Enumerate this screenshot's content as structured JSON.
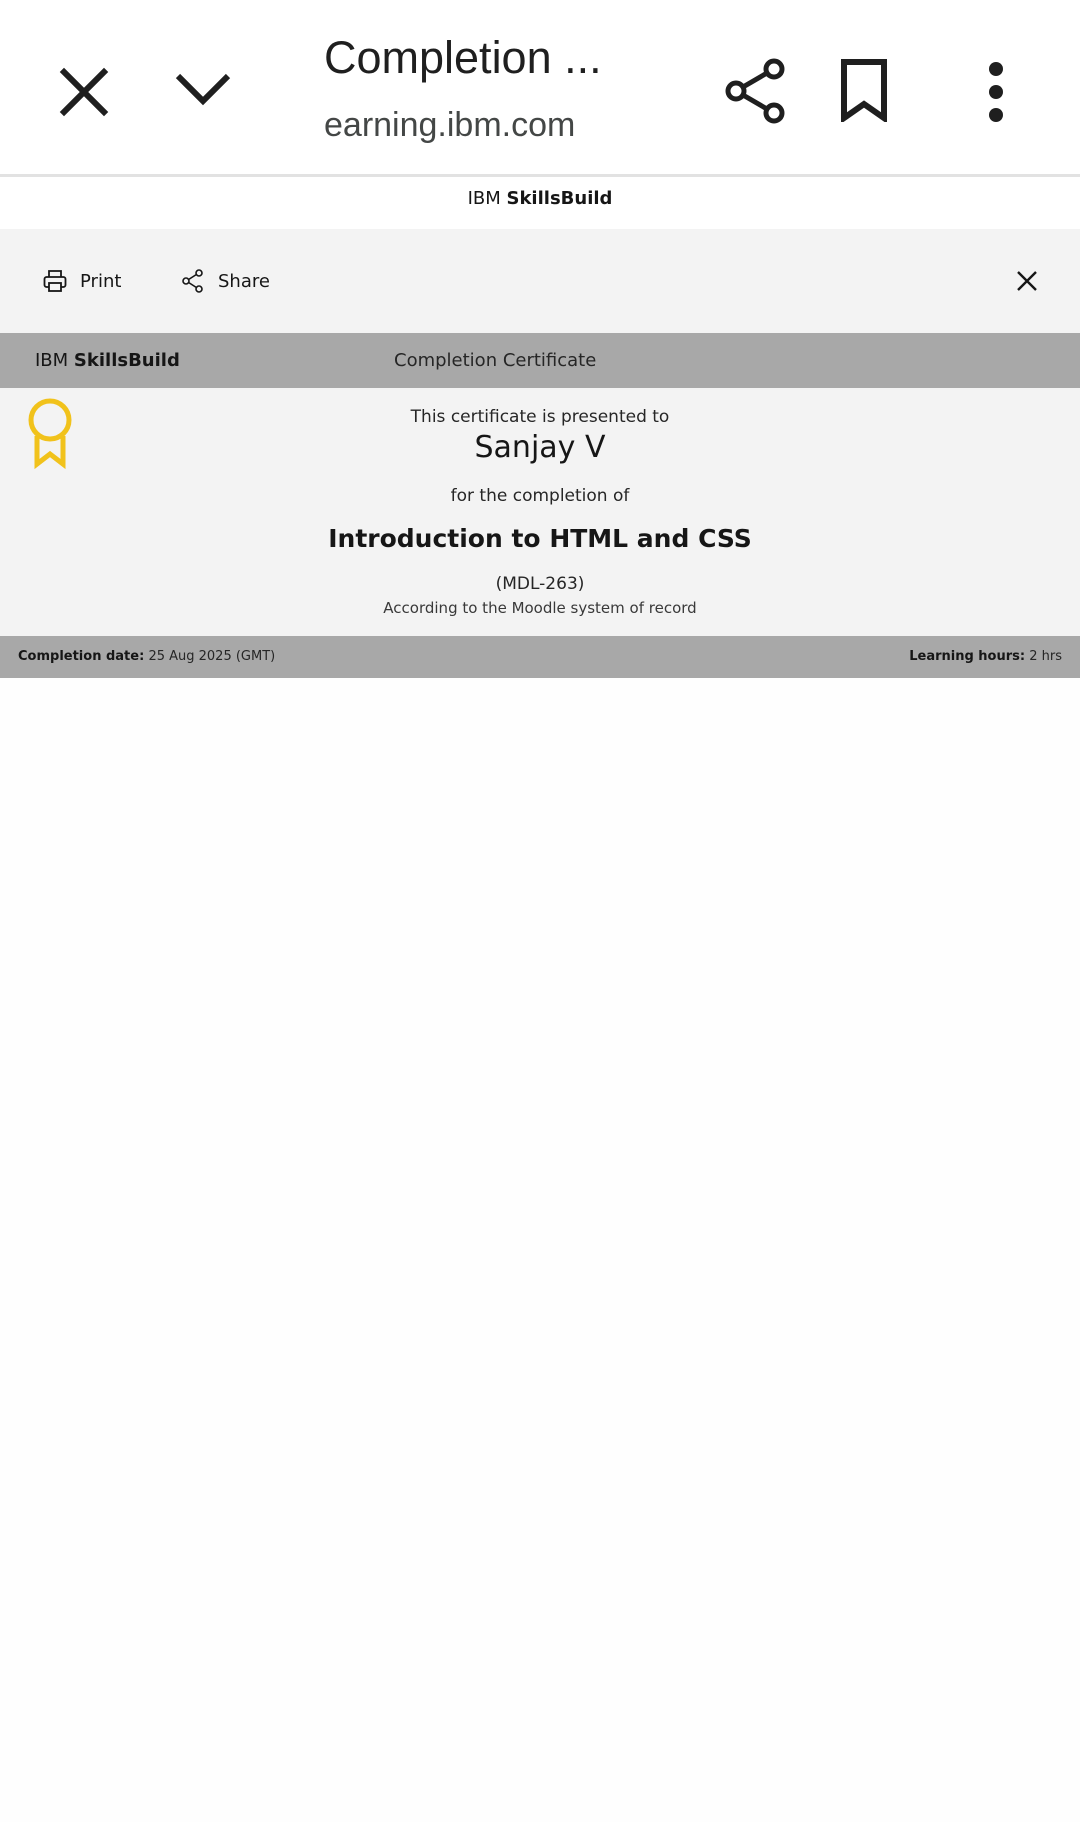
{
  "browser": {
    "title": "Completion ...",
    "url": "earning.ibm.com",
    "icons": {
      "close": "close-icon",
      "minimize": "chevron-down-icon",
      "share": "share-icon",
      "bookmark": "bookmark-icon",
      "more": "more-vert-icon"
    }
  },
  "site_header": {
    "brand_prefix": "IBM",
    "brand_name": "SkillsBuild"
  },
  "actions": {
    "print_label": "Print",
    "share_label": "Share"
  },
  "certificate": {
    "brand_prefix": "IBM",
    "brand_name": "SkillsBuild",
    "header_title": "Completion Certificate",
    "presented_text": "This certificate is presented to",
    "recipient": "Sanjay V",
    "for_text": "for the completion of",
    "course_name": "Introduction to HTML and CSS",
    "course_code": "(MDL-263)",
    "record_note": "According to the Moodle system of record",
    "completion_label": "Completion date:",
    "completion_value": "25 Aug 2025 (GMT)",
    "hours_label": "Learning hours:",
    "hours_value": "2 hrs",
    "medal_color": "#f1c21b"
  }
}
